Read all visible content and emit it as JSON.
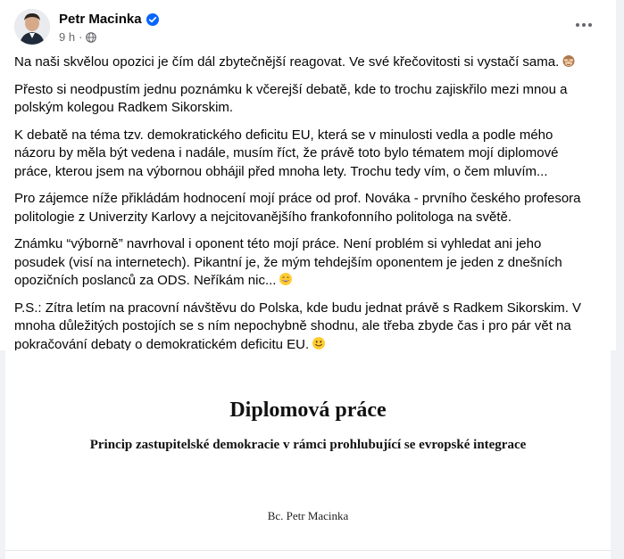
{
  "post": {
    "author": "Petr Macinka",
    "timestamp": "9 h",
    "meta_separator": "·",
    "privacy_icon": "globe-icon",
    "verified_icon": "verified-badge-icon",
    "more_icon": "more-options-icon",
    "paragraphs": [
      {
        "text": "Na naši skvělou opozici je čím dál zbytečnější reagovat. Ve své křečovitosti si vystačí sama.",
        "emoji": "see-no-evil-monkey-emoji"
      },
      {
        "text": "Přesto si neodpustím jednu poznámku k včerejší debatě, kde to trochu zajiskřilo mezi mnou a polským kolegou Radkem Sikorskim."
      },
      {
        "text": "K debatě na téma tzv. demokratického deficitu EU, která se v minulosti vedla a podle mého názoru by měla být vedena i nadále, musím říct, že právě toto bylo tématem mojí diplomové práce, kterou jsem na výbornou obhájil před mnoha lety. Trochu tedy vím, o čem mluvím..."
      },
      {
        "text": "Pro zájemce níže přikládám hodnocení mojí práce od prof. Nováka - prvního českého profesora politologie z Univerzity Karlovy a nejcitovanějšího frankofonního politologa na světě."
      },
      {
        "text": "Známku “výborně” navrhoval i oponent této mojí práce. Není problém si vyhledat ani jeho posudek (visí na internetech). Pikantní je, že mým tehdejším oponentem je jeden z dnešních opozičních poslanců za ODS. Neříkám nic...",
        "emoji": "grinning-face-emoji"
      },
      {
        "text": "P.S.: Zítra letím na pracovní návštěvu do Polska, kde budu jednat právě s Radkem Sikorskim. V mnoha důležitých postojích se s ním nepochybně shodnu, ale třeba zbyde čas i pro pár vět na pokračování debaty o demokratickém deficitu EU.",
        "emoji": "smiling-face-emoji"
      }
    ]
  },
  "attachment": {
    "title": "Diplomová práce",
    "subtitle": "Princip zastupitelské demokracie v rámci prohlubující se evropské integrace",
    "author": "Bc. Petr Macinka"
  },
  "colors": {
    "verified_blue": "#0866ff",
    "secondary_text": "#65676b",
    "primary_text": "#050505",
    "emoji_yellow": "#ffcc33"
  }
}
